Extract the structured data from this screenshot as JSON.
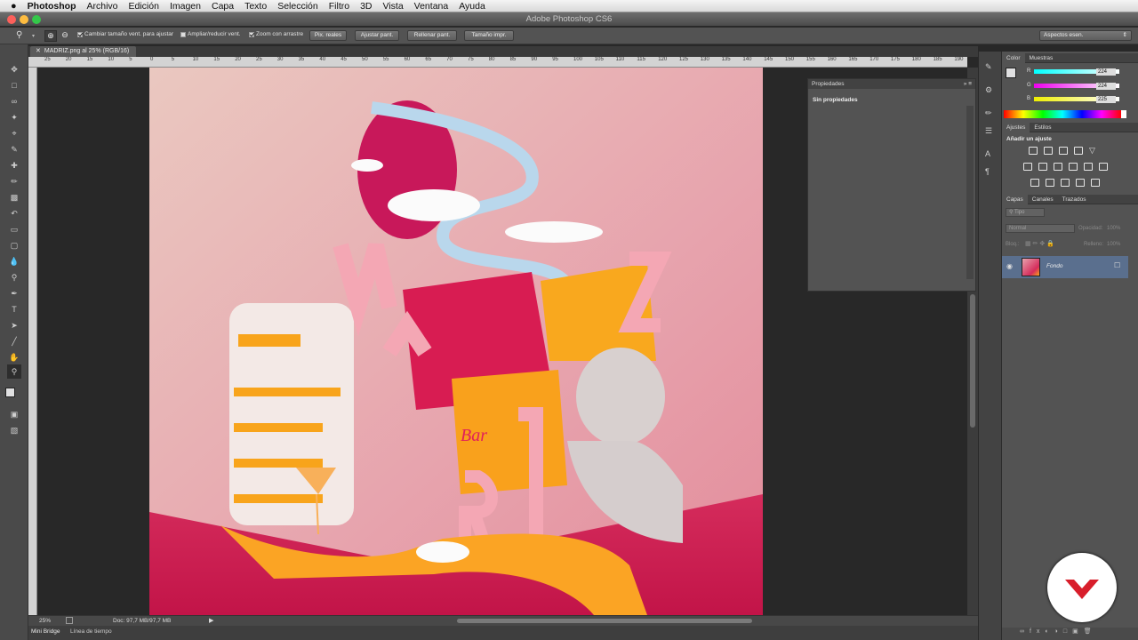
{
  "menubar": {
    "apple_icon": "apple-icon",
    "app": "Photoshop",
    "items": [
      "Archivo",
      "Edición",
      "Imagen",
      "Capa",
      "Texto",
      "Selección",
      "Filtro",
      "3D",
      "Vista",
      "Ventana",
      "Ayuda"
    ]
  },
  "window": {
    "title": "Adobe Photoshop CS6"
  },
  "options": {
    "fit_window": "Cambiar tamaño vent. para ajustar",
    "zoom_all": "Ampliar/reducir vent.",
    "scrubby": "Zoom con arrastre",
    "actual_pixels": "Pix. reales",
    "fit_screen": "Ajustar pant.",
    "fill_screen": "Rellenar pant.",
    "print_size": "Tamaño impr.",
    "workspace": "Aspectos esen."
  },
  "document": {
    "tab": "MADRIZ.png al 25% (RGB/16)"
  },
  "ruler_ticks": [
    "25",
    "20",
    "15",
    "10",
    "5",
    "0",
    "5",
    "10",
    "15",
    "20",
    "25",
    "30",
    "35",
    "40",
    "45",
    "50",
    "55",
    "60",
    "65",
    "70",
    "75",
    "80",
    "85",
    "90",
    "95",
    "100",
    "105",
    "110",
    "115",
    "120",
    "125",
    "130",
    "135",
    "140",
    "145",
    "150",
    "155",
    "160",
    "165",
    "170",
    "175",
    "180",
    "185",
    "190"
  ],
  "status": {
    "zoom": "25%",
    "doc": "Doc: 97,7 MB/97,7 MB"
  },
  "bottom_tabs": [
    "Mini Bridge",
    "Línea de tiempo"
  ],
  "properties": {
    "title": "Propiedades",
    "empty": "Sin propiedades"
  },
  "color_panel": {
    "tabs": [
      "Color",
      "Muestras"
    ],
    "r_label": "R",
    "g_label": "G",
    "b_label": "B",
    "r": "224",
    "g": "224",
    "b": "225"
  },
  "adjustments": {
    "tabs": [
      "Ajustes",
      "Estilos"
    ],
    "title": "Añadir un ajuste"
  },
  "layers": {
    "tabs": [
      "Capas",
      "Canales",
      "Trazados"
    ],
    "filter": "Tipo",
    "blend": "Normal",
    "opacity_label": "Opacidad:",
    "opacity": "100%",
    "lock_label": "Bloq.:",
    "fill_label": "Relleno:",
    "fill": "100%",
    "layer_name": "Fondo"
  },
  "colors": {
    "accent": "#cc1f4e",
    "panel": "#535353",
    "selected_layer": "#5a6f8e"
  }
}
